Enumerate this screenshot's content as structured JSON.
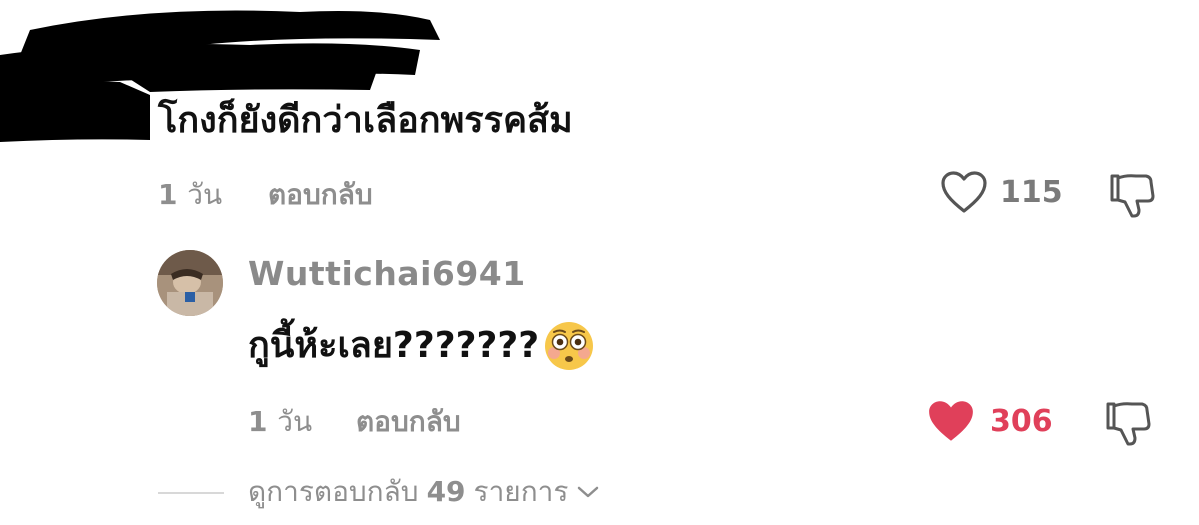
{
  "top_comment": {
    "text": "โกงก็ยังดีกว่าเลือกพรรคส้ม",
    "time_number": "1",
    "time_unit": "วัน",
    "reply_label": "ตอบกลับ",
    "like_count": "115",
    "like_icon": "heart-outline-icon",
    "dislike_icon": "thumbs-down-outline-icon"
  },
  "reply": {
    "username": "Wuttichai6941",
    "text": "กูนี้ห้ะเลย???????",
    "emoji": "flushed-face-emoji",
    "time_number": "1",
    "time_unit": "วัน",
    "reply_label": "ตอบกลับ",
    "like_count": "306",
    "like_icon": "heart-filled-icon",
    "liked_color": "#e0405a",
    "dislike_icon": "thumbs-down-outline-icon"
  },
  "view_replies": {
    "prefix": "ดูการตอบกลับ",
    "count": "49",
    "suffix": "รายการ",
    "icon": "chevron-down-icon"
  }
}
